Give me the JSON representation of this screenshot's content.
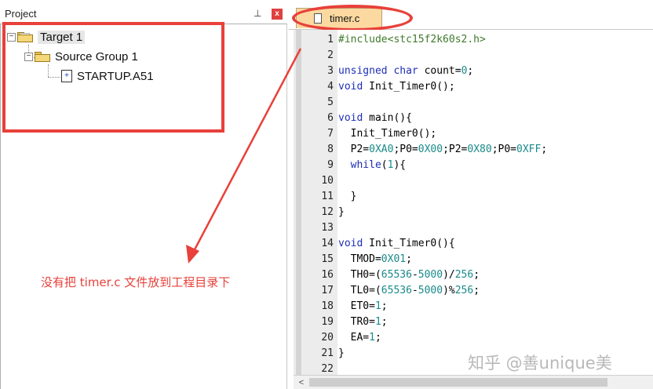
{
  "project_panel": {
    "title": "Project",
    "pin_glyph": "ᵖ",
    "close_glyph": "x",
    "tree": {
      "target": {
        "label": "Target 1",
        "toggle": "−",
        "icon": "target-folder-icon"
      },
      "group": {
        "label": "Source Group 1",
        "toggle": "−",
        "icon": "folder-icon"
      },
      "file": {
        "label": "STARTUP.A51",
        "icon": "asm-file-icon",
        "glyph": "+"
      }
    }
  },
  "annotation": {
    "text": "没有把 timer.c 文件放到工程目录下",
    "color": "#e8403a"
  },
  "editor": {
    "tab": {
      "label": "timer.c",
      "icon": "c-file-icon"
    },
    "lines": [
      {
        "n": "1",
        "code": "#include<stc15f2k60s2.h>"
      },
      {
        "n": "2",
        "code": ""
      },
      {
        "n": "3",
        "code": "unsigned char count=0;"
      },
      {
        "n": "4",
        "code": "void Init_Timer0();"
      },
      {
        "n": "5",
        "code": ""
      },
      {
        "n": "6",
        "code": "void main(){"
      },
      {
        "n": "7",
        "code": "  Init_Timer0();"
      },
      {
        "n": "8",
        "code": "  P2=0XA0;P0=0X00;P2=0X80;P0=0XFF;"
      },
      {
        "n": "9",
        "code": "  while(1){"
      },
      {
        "n": "10",
        "code": ""
      },
      {
        "n": "11",
        "code": "  }"
      },
      {
        "n": "12",
        "code": "}"
      },
      {
        "n": "13",
        "code": ""
      },
      {
        "n": "14",
        "code": "void Init_Timer0(){"
      },
      {
        "n": "15",
        "code": "  TMOD=0X01;"
      },
      {
        "n": "16",
        "code": "  TH0=(65536-5000)/256;"
      },
      {
        "n": "17",
        "code": "  TL0=(65536-5000)%256;"
      },
      {
        "n": "18",
        "code": "  ET0=1;"
      },
      {
        "n": "19",
        "code": "  TR0=1;"
      },
      {
        "n": "20",
        "code": "  EA=1;"
      },
      {
        "n": "21",
        "code": "}"
      },
      {
        "n": "22",
        "code": ""
      }
    ],
    "scroll_left_glyph": "<"
  },
  "watermark": "知乎 @善unique美",
  "colors": {
    "keyword": "#1e2fb8",
    "number": "#1a8a8a",
    "include": "#3e7a2a",
    "highlight": "#e8403a",
    "tab_bg": "#fbd9a0"
  }
}
